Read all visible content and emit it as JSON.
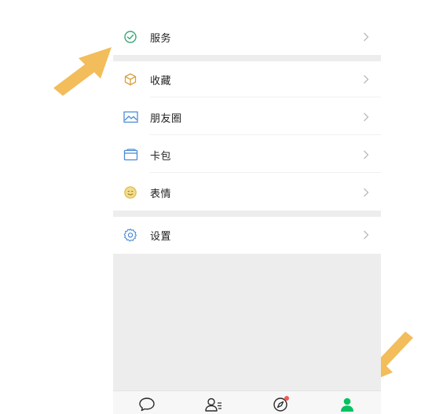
{
  "menu": {
    "items": [
      {
        "label": "服务",
        "icon": "service-icon"
      },
      {
        "label": "收藏",
        "icon": "favorites-icon"
      },
      {
        "label": "朋友圈",
        "icon": "moments-icon"
      },
      {
        "label": "卡包",
        "icon": "card-wallet-icon"
      },
      {
        "label": "表情",
        "icon": "sticker-icon"
      },
      {
        "label": "设置",
        "icon": "settings-icon"
      }
    ]
  },
  "tabbar": {
    "tabs": [
      {
        "name": "chats",
        "icon": "chat-bubble-icon"
      },
      {
        "name": "contacts",
        "icon": "contacts-icon"
      },
      {
        "name": "discover",
        "icon": "compass-icon",
        "badge": true
      },
      {
        "name": "me",
        "icon": "person-icon",
        "active": true
      }
    ]
  },
  "colors": {
    "accent": "#07c160",
    "annotation_arrow": "#f2bd5a",
    "badge": "#f25a55"
  }
}
